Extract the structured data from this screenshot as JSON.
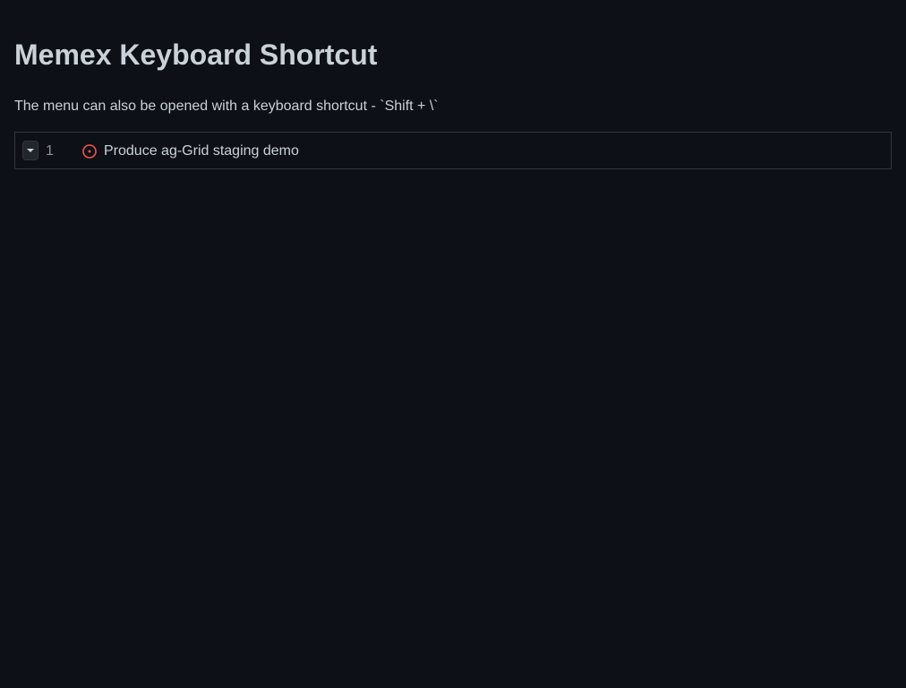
{
  "page": {
    "title": "Memex Keyboard Shortcut",
    "description": "The menu can also be opened with a keyboard shortcut - `Shift + \\`"
  },
  "rows": [
    {
      "number": "1",
      "title": "Produce ag-Grid staging demo",
      "status_icon": "issue-opened-icon"
    }
  ],
  "colors": {
    "background": "#0d1117",
    "text": "#c9d1d9",
    "border": "#30363d",
    "issue_open": "#f85149"
  }
}
